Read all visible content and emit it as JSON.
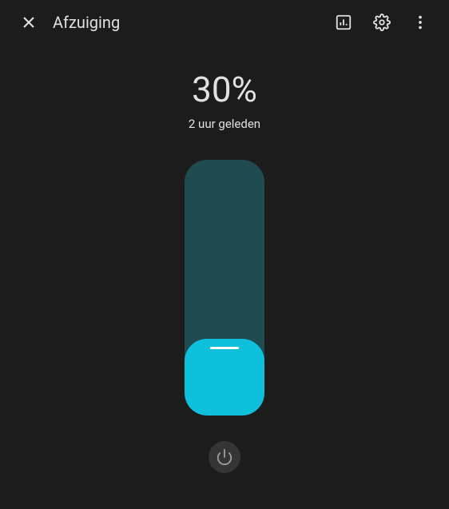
{
  "header": {
    "title": "Afzuiging"
  },
  "status": {
    "percentage": "30%",
    "timestamp": "2 uur geleden",
    "level": 30
  }
}
